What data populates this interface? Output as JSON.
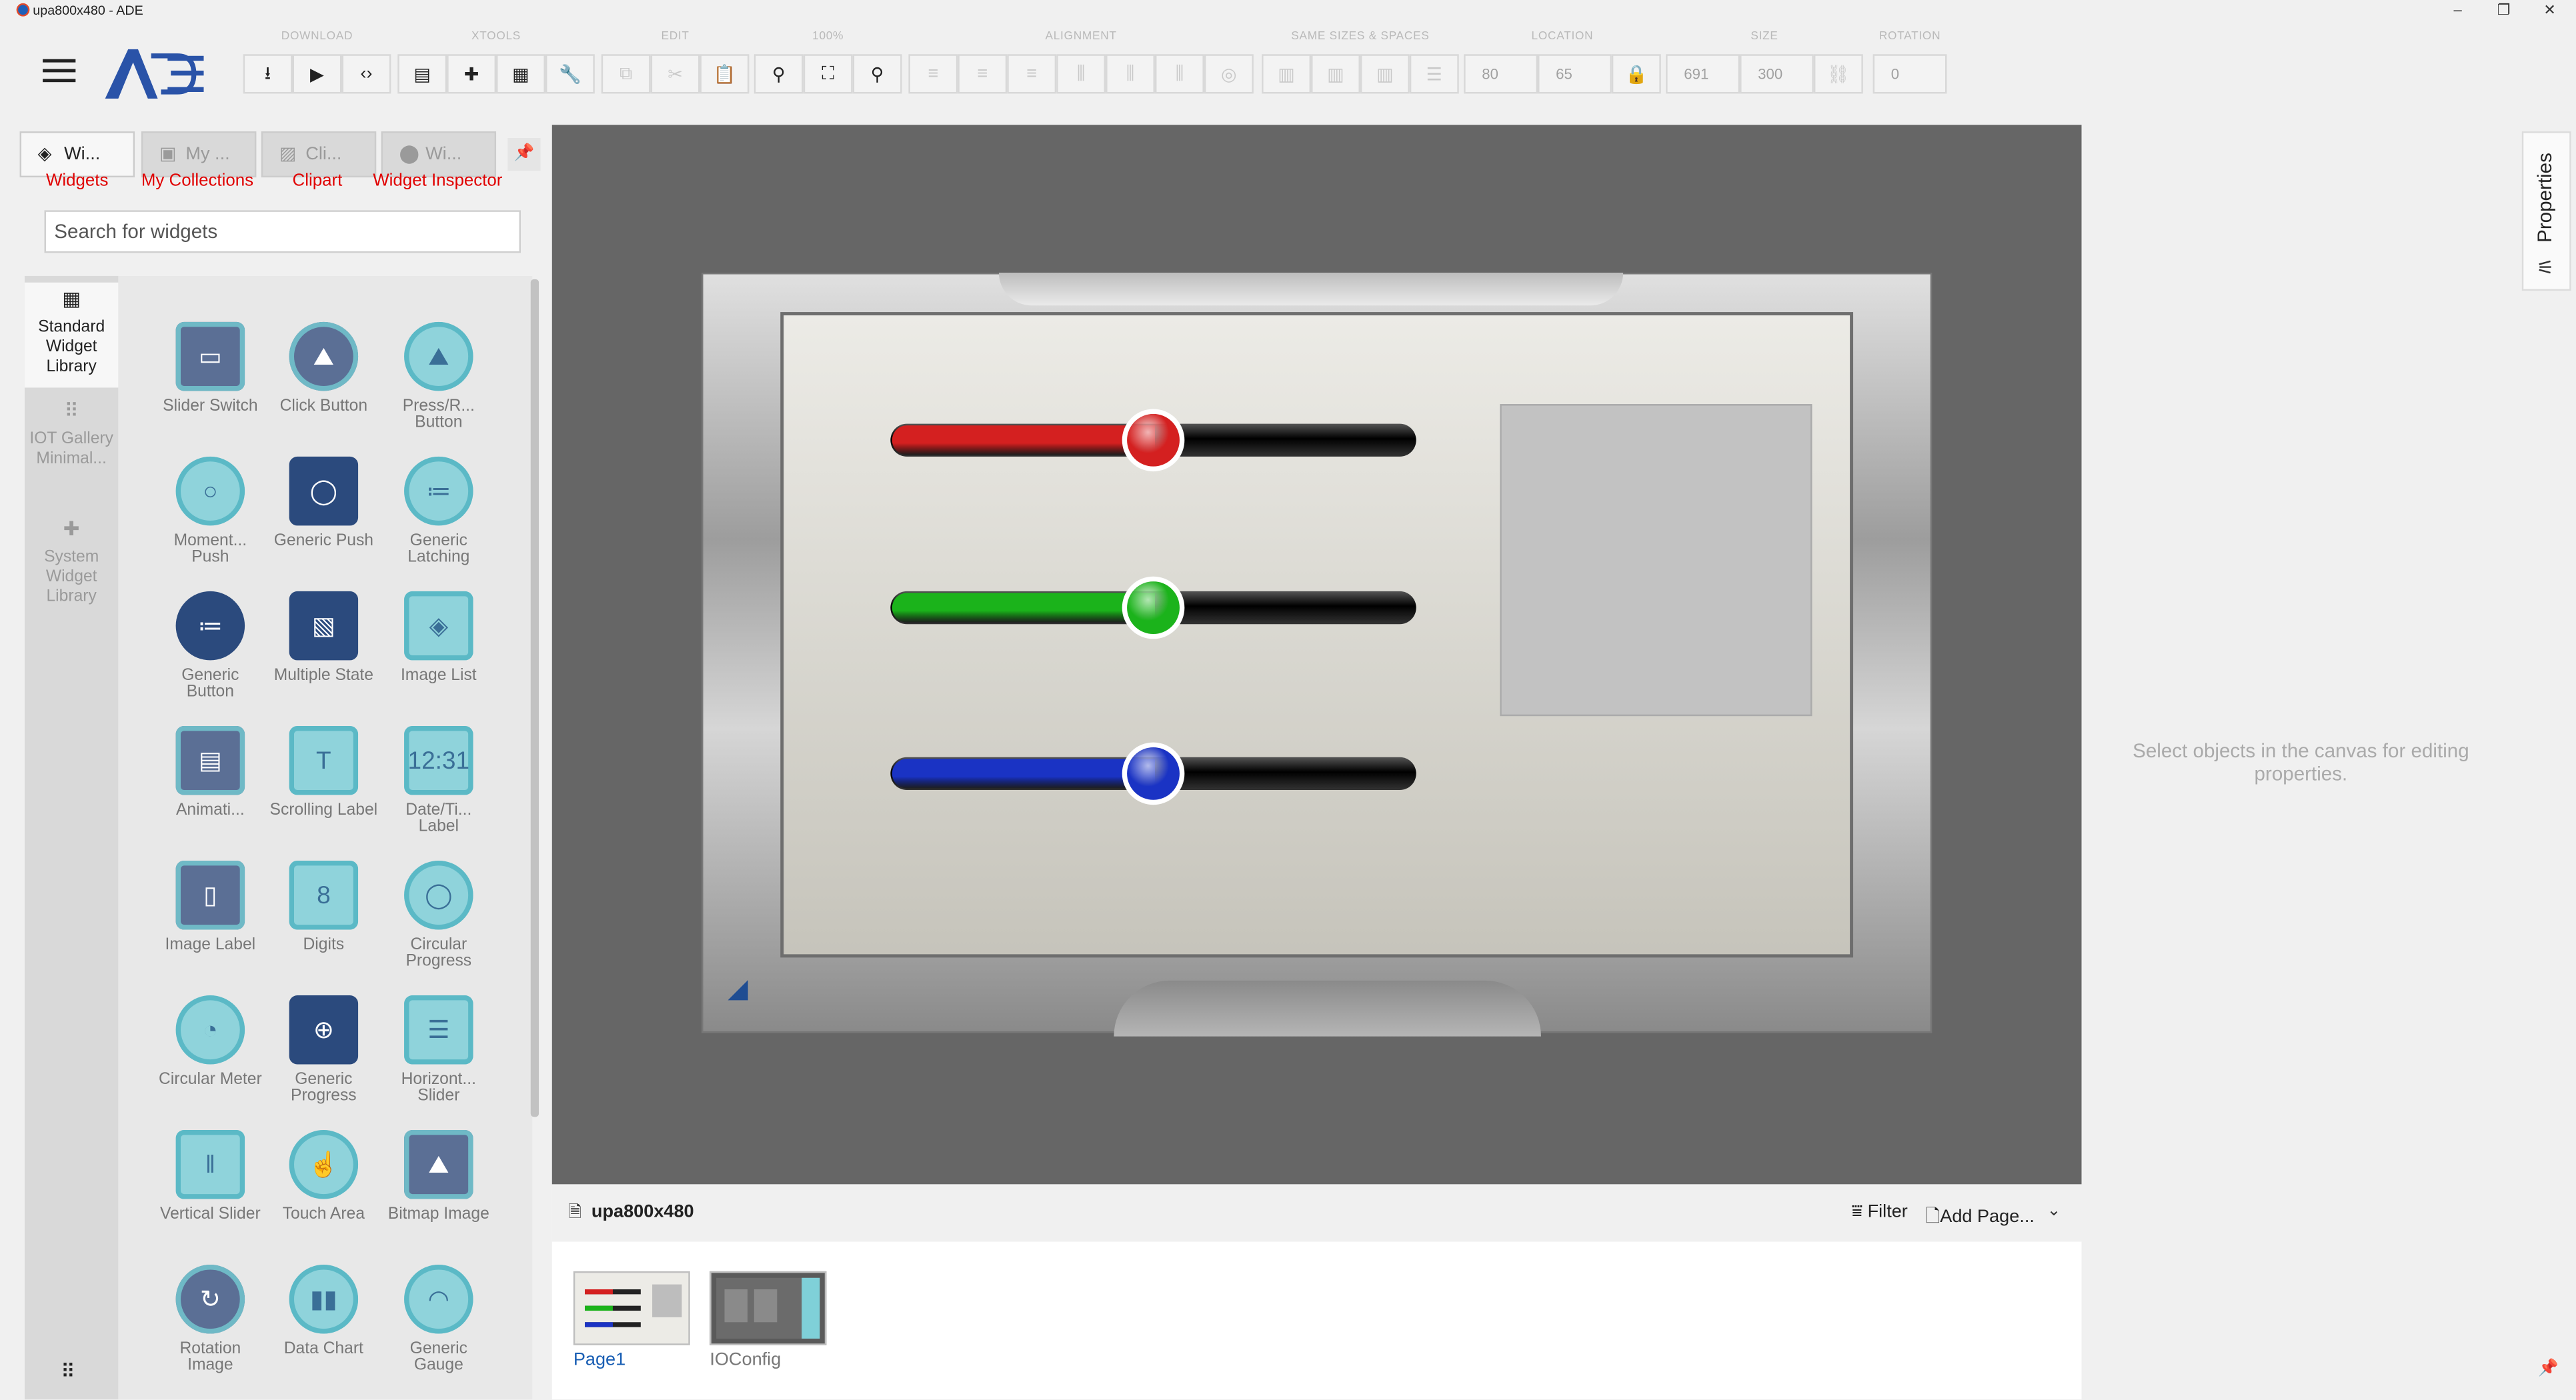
{
  "window": {
    "title": "upa800x480 - ADE",
    "minimize": "–",
    "restore": "❐",
    "close": "✕"
  },
  "toolbar": {
    "menu_icon": "hamburger-icon",
    "groups": {
      "download": "DOWNLOAD",
      "xtools": "XTOOLS",
      "edit": "EDIT",
      "zoom": "100%",
      "alignment": "ALIGNMENT",
      "same_sizes": "SAME SIZES & SPACES",
      "location": "LOCATION",
      "size": "SIZE",
      "rotation": "ROTATION"
    },
    "location_x": "80",
    "location_y": "65",
    "size_w": "691",
    "size_h": "300",
    "rotation": "0"
  },
  "left_panel": {
    "tabs": [
      {
        "short": "Wi...",
        "label": "Widgets",
        "icon": "layers-icon"
      },
      {
        "short": "My ...",
        "label": "My Collections",
        "icon": "briefcase-icon"
      },
      {
        "short": "Cli...",
        "label": "Clipart",
        "icon": "image-icon"
      },
      {
        "short": "Wi...",
        "label": "Widget Inspector",
        "icon": "location-pin-icon"
      }
    ],
    "search_placeholder": "Search for widgets",
    "libraries": [
      {
        "label": "Standard Widget Library",
        "icon": "widget-library-icon"
      },
      {
        "label": "IOT Gallery Minimal...",
        "icon": "grid-icon"
      },
      {
        "label": "System Widget Library",
        "icon": "puzzle-icon"
      }
    ],
    "widgets": [
      {
        "name": "Slider Switch",
        "icon": "slider-switch-icon"
      },
      {
        "name": "Click Button",
        "icon": "click-button-icon"
      },
      {
        "name": "Press/R... Button",
        "icon": "press-release-button-icon"
      },
      {
        "name": "Moment... Push",
        "icon": "momentary-push-icon"
      },
      {
        "name": "Generic Push",
        "icon": "generic-push-icon"
      },
      {
        "name": "Generic Latching",
        "icon": "generic-latching-icon"
      },
      {
        "name": "Generic Button",
        "icon": "generic-button-icon"
      },
      {
        "name": "Multiple State",
        "icon": "multiple-state-icon"
      },
      {
        "name": "Image List",
        "icon": "image-list-icon"
      },
      {
        "name": "Animati...",
        "icon": "animation-icon"
      },
      {
        "name": "Scrolling Label",
        "icon": "scrolling-label-icon"
      },
      {
        "name": "Date/Ti... Label",
        "icon": "datetime-label-icon"
      },
      {
        "name": "Image Label",
        "icon": "image-label-icon"
      },
      {
        "name": "Digits",
        "icon": "digits-icon"
      },
      {
        "name": "Circular Progress",
        "icon": "circular-progress-icon"
      },
      {
        "name": "Circular Meter",
        "icon": "circular-meter-icon"
      },
      {
        "name": "Generic Progress",
        "icon": "generic-progress-icon"
      },
      {
        "name": "Horizont... Slider",
        "icon": "horizontal-slider-icon"
      },
      {
        "name": "Vertical Slider",
        "icon": "vertical-slider-icon"
      },
      {
        "name": "Touch Area",
        "icon": "touch-area-icon"
      },
      {
        "name": "Bitmap Image",
        "icon": "bitmap-image-icon"
      },
      {
        "name": "Rotation Image",
        "icon": "rotation-image-icon"
      },
      {
        "name": "Data Chart",
        "icon": "data-chart-icon"
      },
      {
        "name": "Generic Gauge",
        "icon": "generic-gauge-icon"
      }
    ]
  },
  "canvas": {
    "sliders": [
      {
        "color": "#d42020",
        "value": 0.5
      },
      {
        "color": "#1bb31b",
        "value": 0.5
      },
      {
        "color": "#1a33c4",
        "value": 0.5
      }
    ]
  },
  "pages": {
    "file": "upa800x480",
    "filter": "Filter",
    "add_page": "Add Page...",
    "items": [
      {
        "label": "Page1"
      },
      {
        "label": "IOConfig"
      }
    ]
  },
  "properties": {
    "tab": "Properties",
    "placeholder": "Select objects in the canvas for editing properties."
  }
}
